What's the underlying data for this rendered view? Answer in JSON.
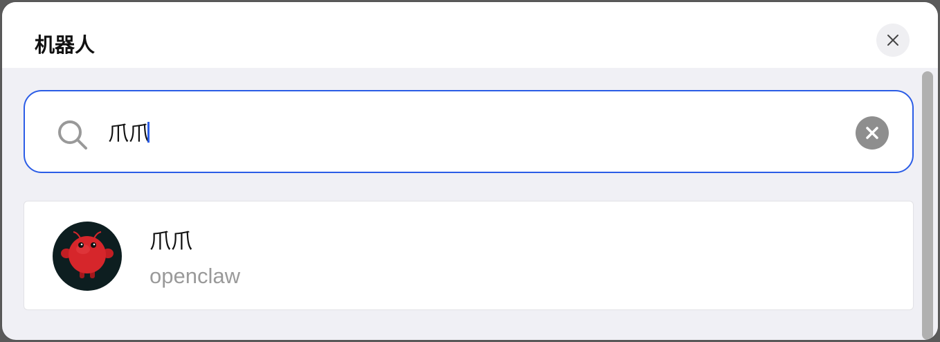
{
  "dialog": {
    "title": "机器人",
    "close_icon": "close-icon"
  },
  "search": {
    "value": "爪爪",
    "placeholder": "",
    "search_icon": "search-icon",
    "clear_icon": "clear-icon"
  },
  "results": [
    {
      "name": "爪爪",
      "id": "openclaw",
      "avatar_icon": "red-robot-avatar"
    }
  ],
  "colors": {
    "accent": "#2a5ce6",
    "background": "#f0f0f5",
    "card": "#ffffff",
    "avatar_bg": "#0d1e20",
    "avatar_body": "#d6262b",
    "muted_text": "#9a9a9a"
  }
}
